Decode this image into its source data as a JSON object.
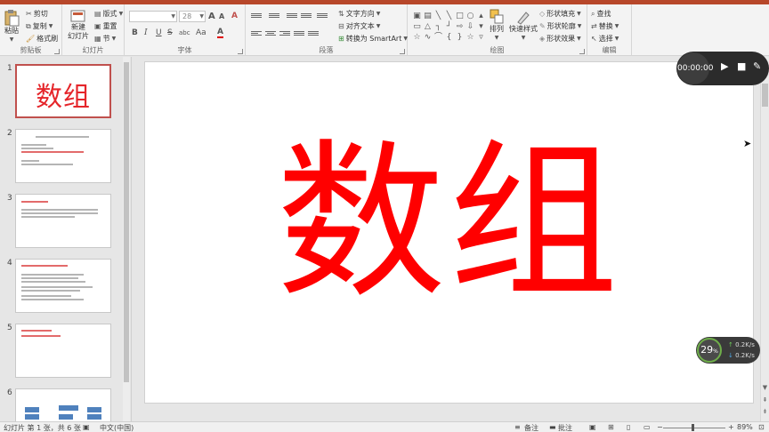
{
  "ribbon": {
    "clipboard": {
      "paste": "粘贴",
      "cut": "剪切",
      "copy": "复制",
      "format_painter": "格式刷",
      "group_label": "剪贴板"
    },
    "slides": {
      "new_slide_line1": "新建",
      "new_slide_line2": "幻灯片",
      "layout": "版式",
      "reset": "重置",
      "section": "节",
      "group_label": "幻灯片"
    },
    "font": {
      "font_size": "28",
      "bold": "B",
      "italic": "I",
      "underline": "U",
      "strike": "S",
      "char_spacing": "abc",
      "case": "Aa",
      "font_color": "A",
      "grow": "A",
      "shrink": "A",
      "clear": "A",
      "group_label": "字体"
    },
    "paragraph": {
      "text_direction": "文字方向",
      "align_text": "对齐文本",
      "smartart": "转换为 SmartArt",
      "group_label": "段落"
    },
    "drawing": {
      "arrange": "排列",
      "quick_styles": "快速样式",
      "shape_fill": "形状填充",
      "shape_outline": "形状轮廓",
      "shape_effects": "形状效果",
      "group_label": "绘图"
    },
    "editing": {
      "find": "查找",
      "replace": "替换",
      "select": "选择",
      "group_label": "编辑"
    }
  },
  "slides": [
    {
      "num": "1",
      "title": "数组"
    },
    {
      "num": "2"
    },
    {
      "num": "3"
    },
    {
      "num": "4"
    },
    {
      "num": "5"
    },
    {
      "num": "6"
    }
  ],
  "slide_main": {
    "title": "数组"
  },
  "recorder": {
    "time": "00:00:00"
  },
  "netmon": {
    "percent": "29",
    "percent_unit": "%",
    "upload": "0.2K/s",
    "download": "0.2K/s"
  },
  "status": {
    "slide_info": "幻灯片 第 1 张，共 6 张",
    "language": "中文(中国)",
    "notes": "备注",
    "comments": "批注",
    "zoom": "89%"
  },
  "colors": {
    "accent": "#b7472a",
    "slide_title": "#ff0000",
    "thumb_border": "#c0504d"
  }
}
